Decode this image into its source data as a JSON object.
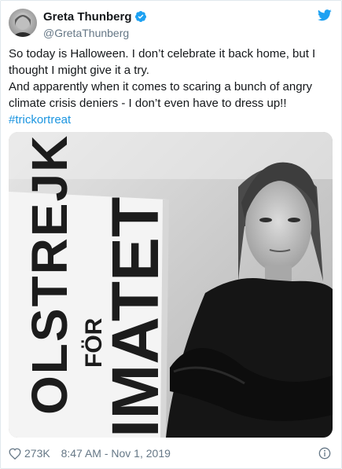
{
  "tweet": {
    "display_name": "Greta Thunberg",
    "handle": "@GretaThunberg",
    "paragraphs": [
      "So today is Halloween. I don’t celebrate it back home, but I thought I might give it a try.",
      "And apparently when it comes to scaring a bunch of angry climate crisis deniers - I don’t even have to dress up!!"
    ],
    "hashtag": "#trickortreat",
    "sign_text_lines": [
      "OLSTREJK",
      "FÖR",
      "IMATET"
    ],
    "likes": "273K",
    "timestamp": "8:47 AM - Nov 1, 2019"
  },
  "icons": {
    "verified": "verified-badge-icon",
    "logo": "twitter-bird-icon",
    "like": "heart-icon",
    "info": "info-icon"
  },
  "colors": {
    "link": "#1b95e0",
    "verified": "#1da1f2",
    "muted": "#657786",
    "text": "#14171a"
  }
}
